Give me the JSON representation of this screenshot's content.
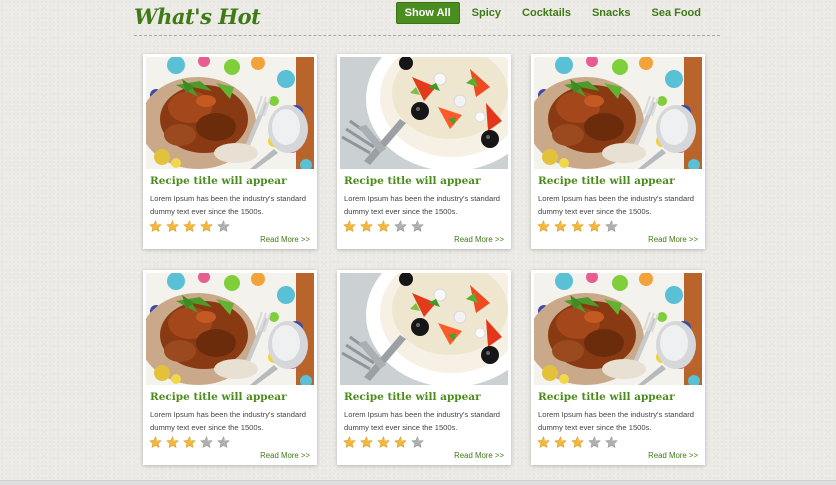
{
  "header": {
    "title": "What's Hot",
    "nav": [
      {
        "label": "Show All",
        "active": true
      },
      {
        "label": "Spicy",
        "active": false
      },
      {
        "label": "Cocktails",
        "active": false
      },
      {
        "label": "Snacks",
        "active": false
      },
      {
        "label": "Sea Food",
        "active": false
      }
    ]
  },
  "colors": {
    "accent": "#4a8e1f",
    "title_green": "#4b8b1b",
    "star_filled": "#f3b73a",
    "star_empty": "#b0b0b0"
  },
  "cards": [
    {
      "image": "chicken-dish",
      "title": "Recipe title will appear",
      "description": "Lorem Ipsum has been the industry's standard dummy text ever since the 1500s.",
      "rating": 4,
      "max_rating": 5,
      "read_more": "Read More >>"
    },
    {
      "image": "salad-dish",
      "title": "Recipe title will appear",
      "description": "Lorem Ipsum has been the industry's standard dummy text ever since the 1500s.",
      "rating": 3,
      "max_rating": 5,
      "read_more": "Read More >>"
    },
    {
      "image": "chicken-dish",
      "title": "Recipe title will appear",
      "description": "Lorem Ipsum has been the industry's standard dummy text ever since the 1500s.",
      "rating": 4,
      "max_rating": 5,
      "read_more": "Read More >>"
    },
    {
      "image": "chicken-dish",
      "title": "Recipe title will appear",
      "description": "Lorem Ipsum has been the industry's standard dummy text ever since the 1500s.",
      "rating": 3,
      "max_rating": 5,
      "read_more": "Read More >>"
    },
    {
      "image": "salad-dish",
      "title": "Recipe title will appear",
      "description": "Lorem Ipsum has been the industry's standard dummy text ever since the 1500s.",
      "rating": 4,
      "max_rating": 5,
      "read_more": "Read More >>"
    },
    {
      "image": "chicken-dish",
      "title": "Recipe title will appear",
      "description": "Lorem Ipsum has been the industry's standard dummy text ever since the 1500s.",
      "rating": 3,
      "max_rating": 5,
      "read_more": "Read More >>"
    }
  ]
}
